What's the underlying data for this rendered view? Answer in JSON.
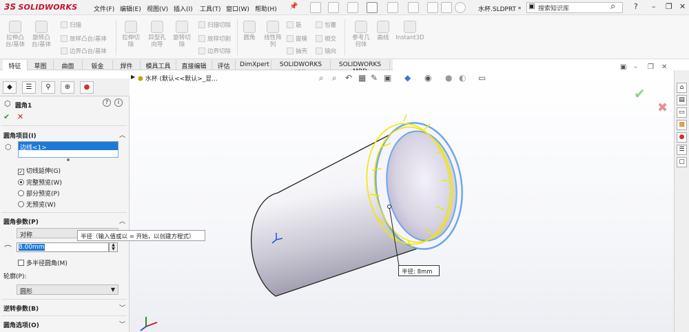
{
  "app": {
    "logo_ds": "3S",
    "logo_text": "SOLIDWORKS",
    "document_title": "水杯.SLDPRT *",
    "search_placeholder": "搜索知识库"
  },
  "menu": [
    "文件(F)",
    "编辑(E)",
    "视图(V)",
    "插入(I)",
    "工具(T)",
    "窗口(W)",
    "帮助(H)"
  ],
  "pin_glyph": "📌",
  "commands": {
    "extrude_boss": "拉伸凸\n台/基体",
    "revolve_boss": "旋转凸\n台/基体",
    "sweep": "扫描",
    "loft_boss": "放样凸台/基体",
    "boundary_boss": "边界凸台/基体",
    "extrude_cut": "拉伸切\n除",
    "hole_wizard": "异型孔\n向导",
    "revolve_cut": "旋转切\n除",
    "swept_cut": "扫描切除",
    "lofted_cut": "放样切割",
    "boundary_cut": "边界切除",
    "fillet": "圆角",
    "linear_pattern": "线性阵\n列",
    "rib": "筋",
    "draft": "拔模",
    "shell": "抽壳",
    "wrap": "包覆",
    "intersect": "相交",
    "mirror": "镜向",
    "ref_geometry": "参考几\n何体",
    "curves": "曲线",
    "instant3d": "Instant3D"
  },
  "tabs": [
    "特征",
    "草图",
    "曲面",
    "钣金",
    "焊件",
    "模具工具",
    "直接编辑",
    "评估",
    "DimXpert",
    "SOLIDWORKS 插件",
    "SOLIDWORKS MBD"
  ],
  "active_tab": "特征",
  "property_manager": {
    "title": "圆角1",
    "help_icon": "?",
    "ok_glyph": "✔",
    "cancel_glyph": "✕",
    "fillet_items": {
      "header": "圆角项目(I)",
      "selected_edge": "边线<1>",
      "tangent_propagation": "切线延伸(G)",
      "full_preview": "完整预览(W)",
      "partial_preview": "部分预览(P)",
      "no_preview": "无预览(W)"
    },
    "fillet_params": {
      "header": "圆角参数(P)",
      "method": "对称",
      "radius": "8.00mm",
      "multi_radius": "多半径圆角(M)",
      "profile_label": "轮廓(P):",
      "profile_value": "圆形"
    },
    "setback_header": "逆转参数(B)",
    "fillet_options_header": "圆角选项(O)"
  },
  "tooltip": "半径（输入值或以 = 开始，以创建方程式）",
  "viewport": {
    "breadcrumb": "水杯 (默认<<默认>_显...",
    "dimension_label": "半径:",
    "dimension_value": "8mm"
  },
  "colors": {
    "selection_blue": "#1e78d6",
    "preview_yellow": "#f0e800",
    "edge_blue": "#6aa8ea",
    "accent_red": "#c8102e"
  }
}
